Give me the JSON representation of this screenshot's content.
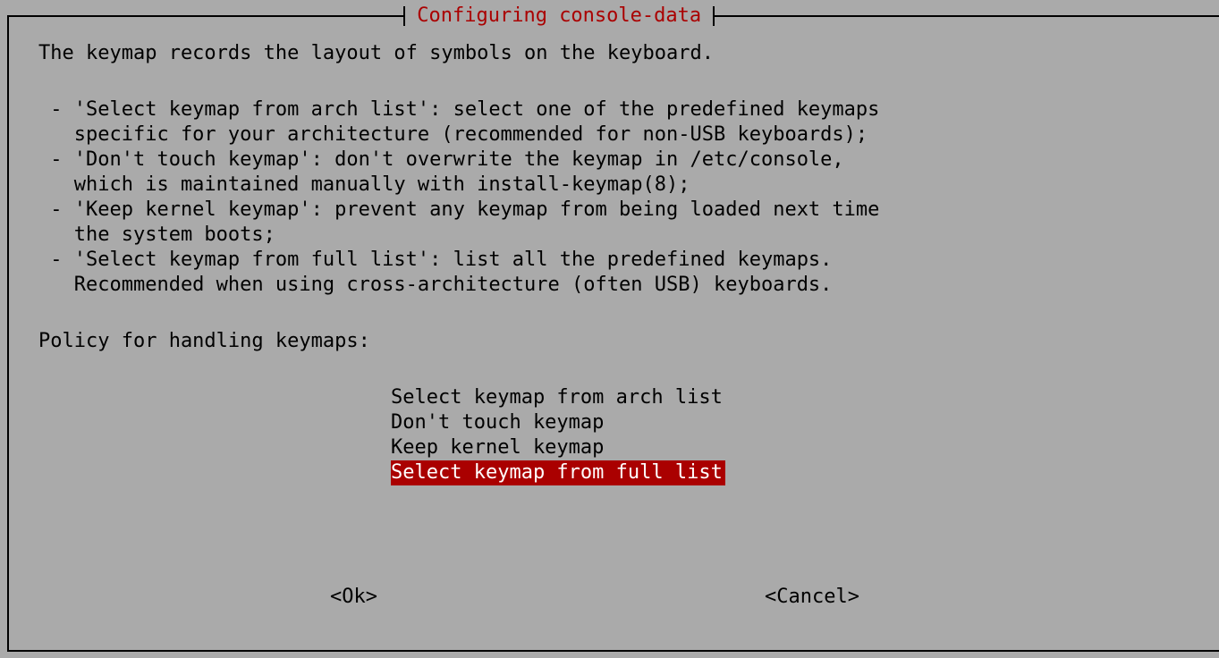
{
  "dialog": {
    "title": "Configuring console-data",
    "lines": [
      "The keymap records the layout of symbols on the keyboard.",
      "",
      " - 'Select keymap from arch list': select one of the predefined keymaps",
      "   specific for your architecture (recommended for non-USB keyboards);",
      " - 'Don't touch keymap': don't overwrite the keymap in /etc/console,",
      "   which is maintained manually with install-keymap(8);",
      " - 'Keep kernel keymap': prevent any keymap from being loaded next time",
      "   the system boots;",
      " - 'Select keymap from full list': list all the predefined keymaps.",
      "   Recommended when using cross-architecture (often USB) keyboards.",
      "",
      "Policy for handling keymaps:"
    ],
    "options": [
      "Select keymap from arch list",
      "Don't touch keymap",
      "Keep kernel keymap",
      "Select keymap from full list"
    ],
    "selected_option": "Select keymap from full list",
    "ok_label": "<Ok>",
    "cancel_label": "<Cancel>"
  },
  "colors": {
    "background": "#aaaaaa",
    "highlight": "#aa0000",
    "title_text": "#aa0000",
    "text": "#000000"
  }
}
